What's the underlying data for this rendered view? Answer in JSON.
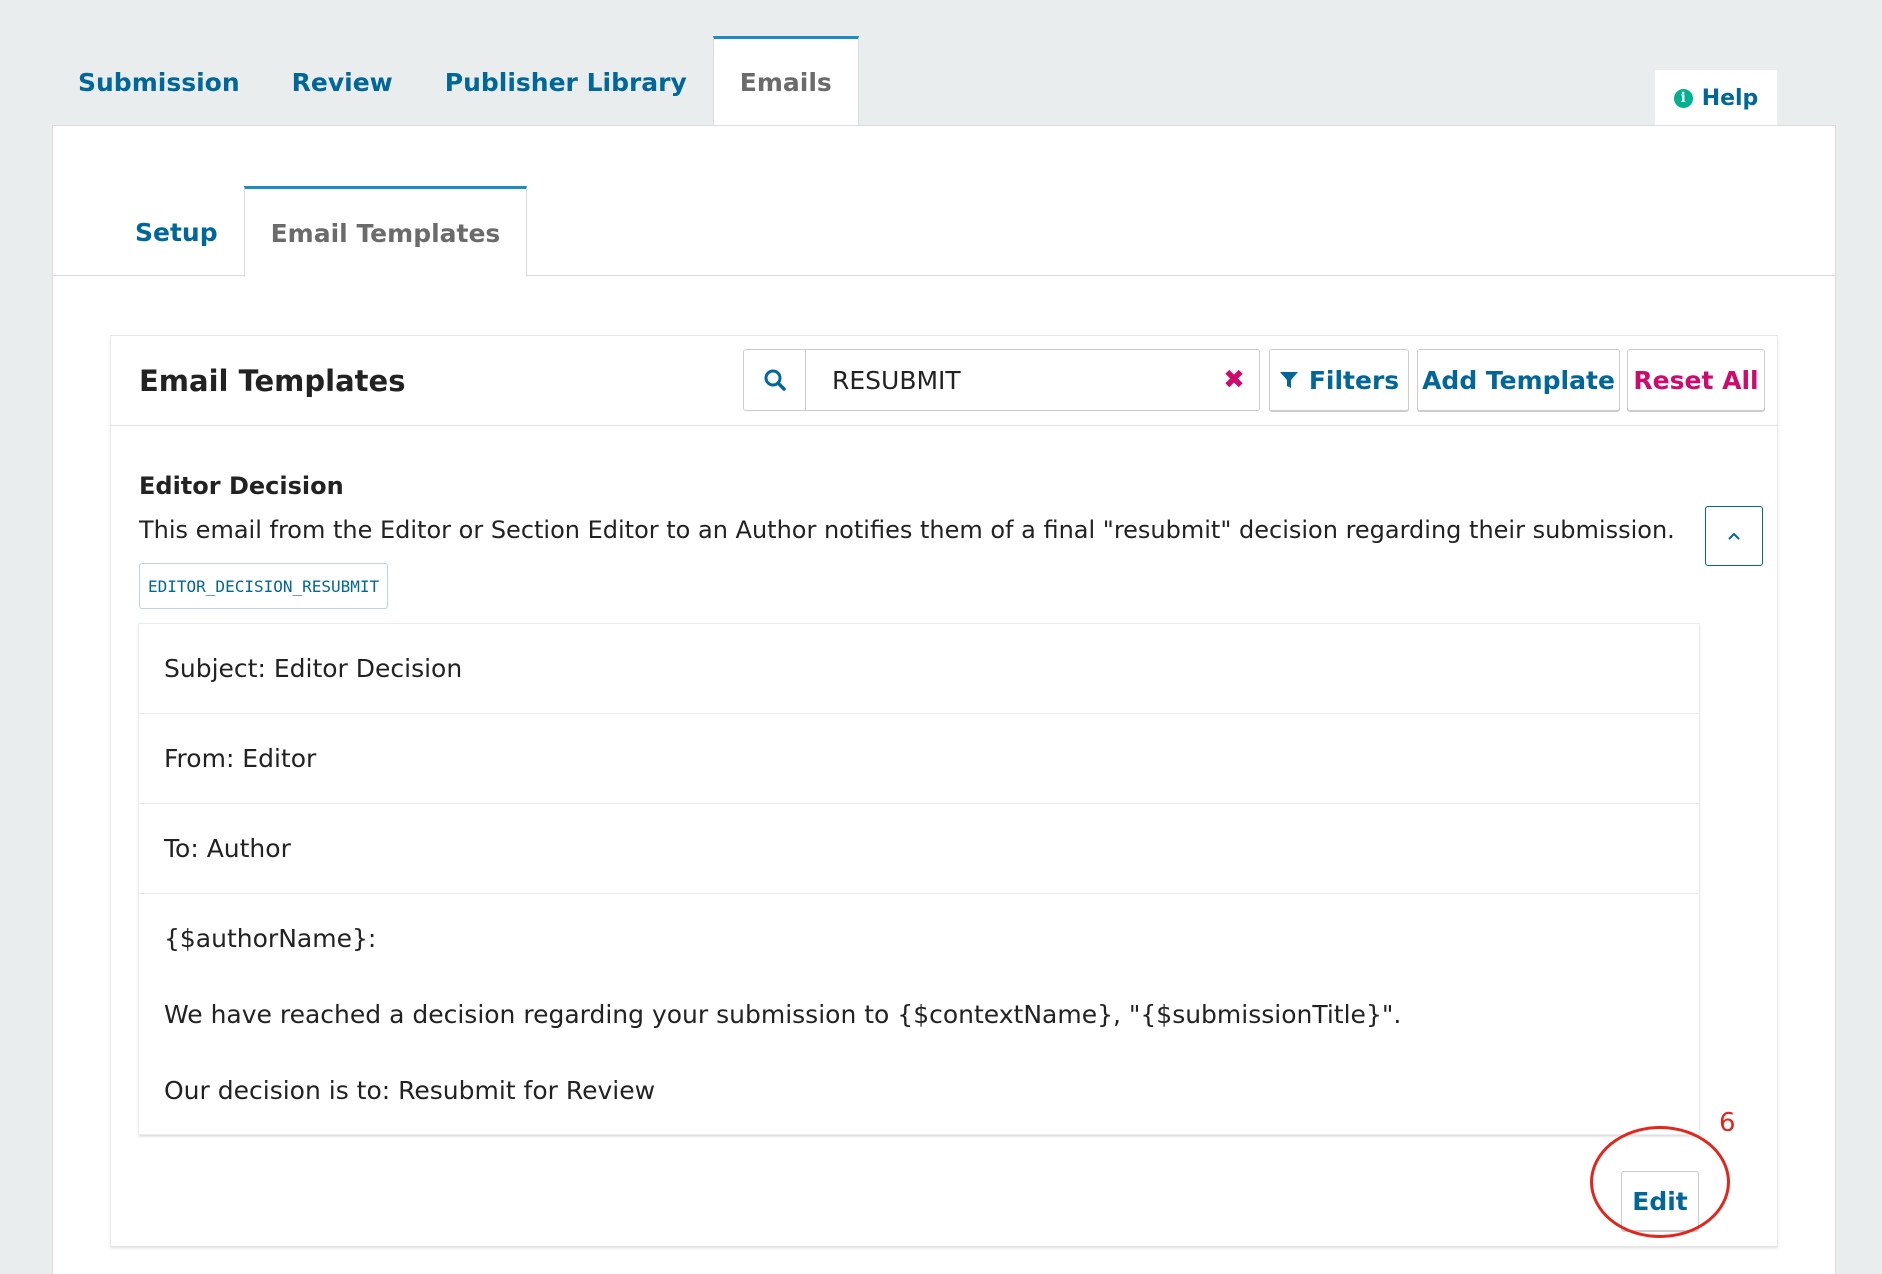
{
  "top_tabs": [
    {
      "label": "Submission"
    },
    {
      "label": "Review"
    },
    {
      "label": "Publisher Library"
    },
    {
      "label": "Emails"
    }
  ],
  "help": {
    "label": "Help"
  },
  "sub_tabs": [
    {
      "label": "Setup"
    },
    {
      "label": "Email Templates"
    }
  ],
  "card": {
    "title": "Email Templates",
    "search_value": "RESUBMIT",
    "filters_label": "Filters",
    "add_label": "Add Template",
    "reset_label": "Reset All"
  },
  "template": {
    "name": "Editor Decision",
    "description": "This email from the Editor or Section Editor to an Author notifies them of a final \"resubmit\" decision regarding their submission.",
    "key": "EDITOR_DECISION_RESUBMIT",
    "subject": "Subject: Editor Decision",
    "from": "From: Editor",
    "to": "To: Author",
    "body": [
      "{$authorName}:",
      "We have reached a decision regarding your submission to {$contextName}, \"{$submissionTitle}\".",
      "Our decision is to: Resubmit for Review"
    ],
    "edit_label": "Edit"
  },
  "annotation": {
    "number": "6",
    "color": "#e2261c"
  },
  "colors": {
    "link": "#006798",
    "danger": "#d00a6c",
    "active_tab_border": "#1e8bc3",
    "help_icon": "#00b28d"
  }
}
